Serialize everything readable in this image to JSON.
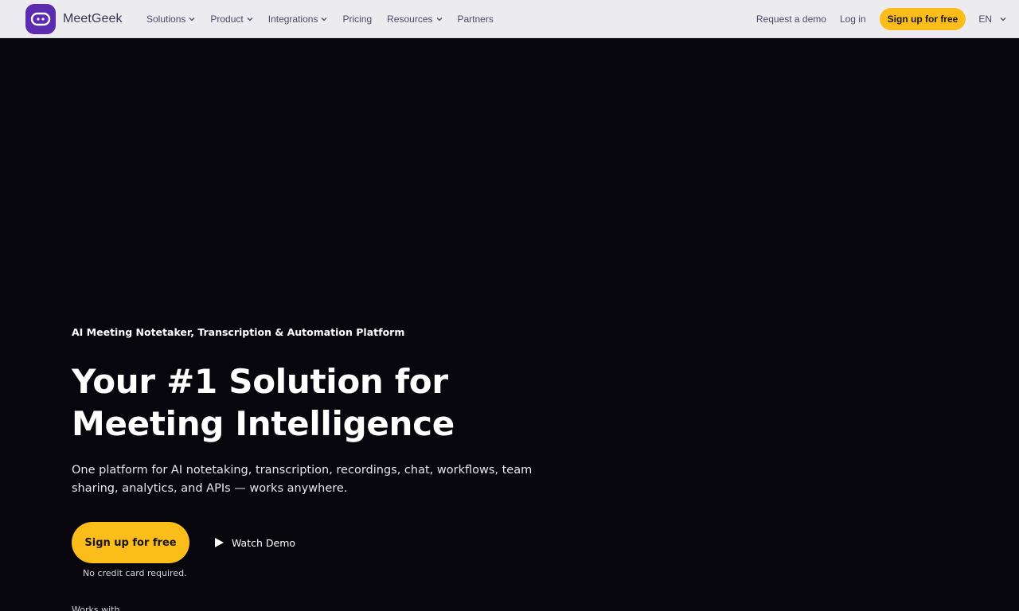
{
  "brand": {
    "name": "MeetGeek",
    "logo_icon": "robot-face-icon",
    "logo_color": "#5b2bb0"
  },
  "nav": {
    "items": [
      {
        "label": "Solutions",
        "has_dropdown": true
      },
      {
        "label": "Product",
        "has_dropdown": true
      },
      {
        "label": "Integrations",
        "has_dropdown": true
      },
      {
        "label": "Pricing",
        "has_dropdown": false
      },
      {
        "label": "Resources",
        "has_dropdown": true
      },
      {
        "label": "Partners",
        "has_dropdown": false
      }
    ],
    "request_demo": "Request a demo",
    "login": "Log in",
    "signup": "Sign up for free",
    "language": "EN"
  },
  "hero": {
    "eyebrow": "AI Meeting Notetaker, Transcription & Automation Platform",
    "headline_line1": "Your #1 Solution for",
    "headline_line2": "Meeting Intelligence",
    "subtext": "One platform for AI notetaking, transcription, recordings, chat, workflows, team sharing, analytics, and APIs — works anywhere.",
    "cta": "Sign up for free",
    "watch_demo": "Watch Demo",
    "watch_icon": "play-icon",
    "note": "No credit card required.",
    "works_with": "Works with"
  },
  "colors": {
    "accent": "#fbbd1a",
    "background": "#07060c",
    "nav_background": "#ececf0",
    "nav_text": "#4c4a63"
  }
}
